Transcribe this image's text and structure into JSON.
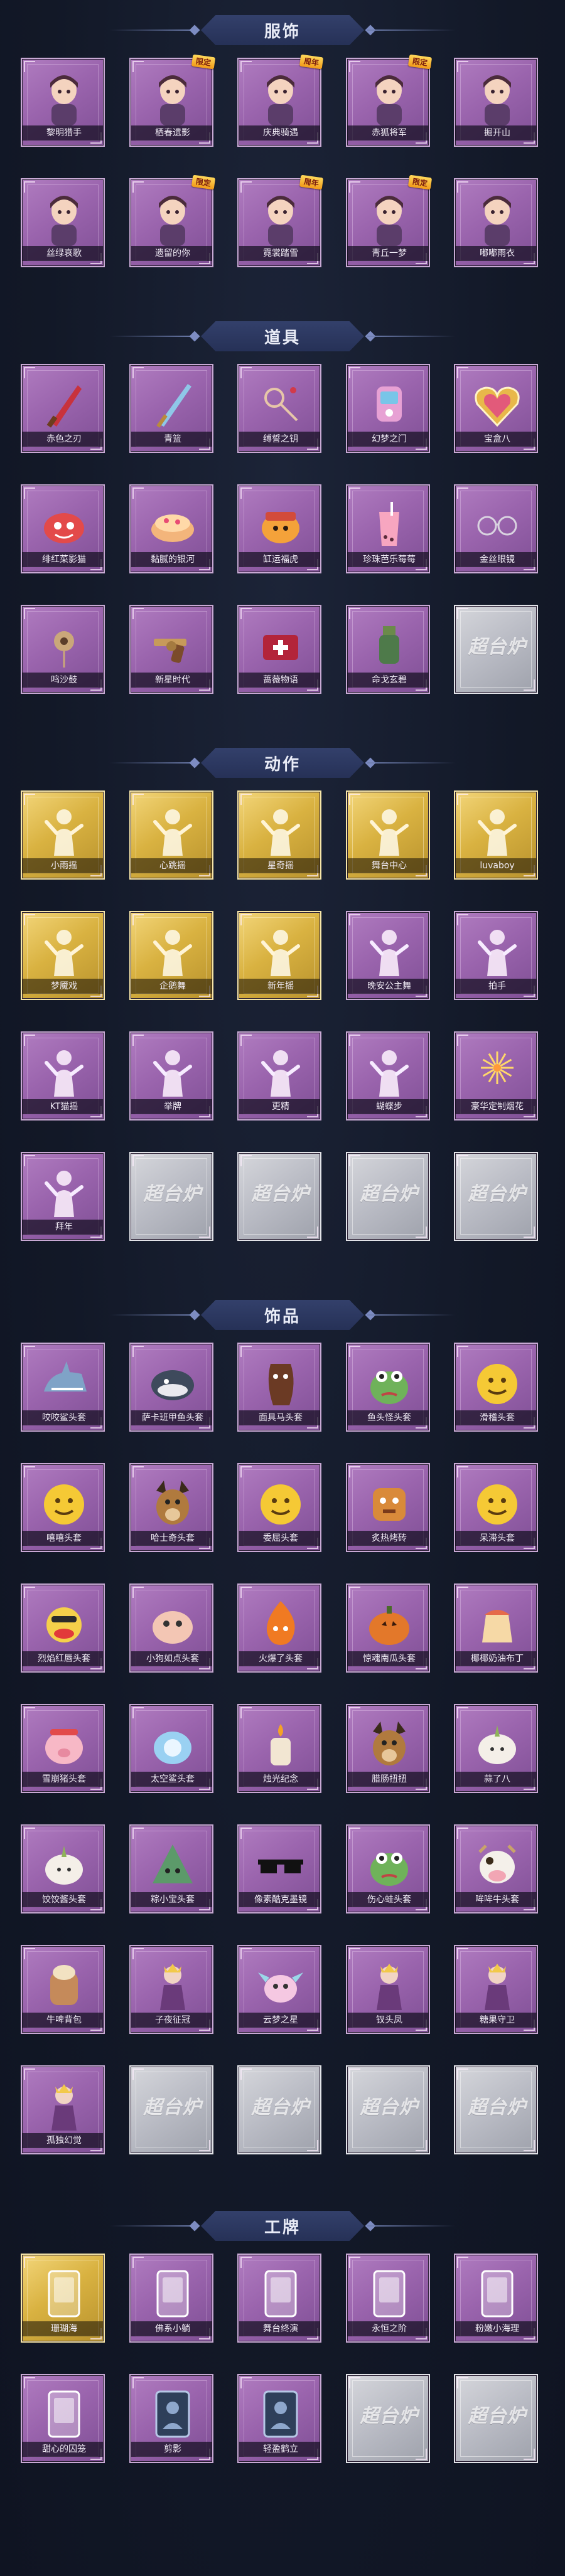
{
  "watermark_text": "超台炉",
  "sections": [
    {
      "title": "服饰",
      "items": [
        {
          "label": "黎明猎手",
          "style": "purple",
          "icon": "character-portrait-icon"
        },
        {
          "label": "栖春遗影",
          "style": "purple",
          "icon": "character-portrait-icon",
          "badge": "限定"
        },
        {
          "label": "庆典骑遇",
          "style": "purple",
          "icon": "character-portrait-icon",
          "badge": "周年"
        },
        {
          "label": "赤狐将军",
          "style": "purple",
          "icon": "character-portrait-icon",
          "badge": "限定"
        },
        {
          "label": "掘开山",
          "style": "purple",
          "icon": "character-portrait-icon"
        },
        {
          "label": "丝绿哀歌",
          "style": "purple",
          "icon": "character-portrait-icon"
        },
        {
          "label": "遗留的你",
          "style": "purple",
          "icon": "character-portrait-icon",
          "badge": "限定"
        },
        {
          "label": "霓裳踏雪",
          "style": "purple",
          "icon": "character-portrait-icon",
          "badge": "周年"
        },
        {
          "label": "青丘一梦",
          "style": "purple",
          "icon": "character-portrait-icon",
          "badge": "限定"
        },
        {
          "label": "嘟嘟雨衣",
          "style": "purple",
          "icon": "character-portrait-icon"
        }
      ]
    },
    {
      "title": "道具",
      "items": [
        {
          "label": "赤色之刃",
          "style": "purple",
          "icon": "blade-icon"
        },
        {
          "label": "青篮",
          "style": "purple",
          "icon": "sword-icon"
        },
        {
          "label": "缚誓之钥",
          "style": "purple",
          "icon": "key-icon"
        },
        {
          "label": "幻梦之门",
          "style": "purple",
          "icon": "device-icon"
        },
        {
          "label": "宝盒八",
          "style": "purple",
          "icon": "heart-box-icon"
        },
        {
          "label": "绯红菜影猫",
          "style": "purple",
          "icon": "red-cat-icon"
        },
        {
          "label": "黏腻的银河",
          "style": "purple",
          "icon": "cake-icon"
        },
        {
          "label": "缸运福虎",
          "style": "purple",
          "icon": "tiger-icon"
        },
        {
          "label": "珍珠芭乐莓莓",
          "style": "purple",
          "icon": "drink-icon"
        },
        {
          "label": "金丝眼镜",
          "style": "purple",
          "icon": "glasses-icon"
        },
        {
          "label": "鸣沙鼓",
          "style": "purple",
          "icon": "ornament-icon"
        },
        {
          "label": "新星时代",
          "style": "purple",
          "icon": "revolver-icon"
        },
        {
          "label": "蔷薇物语",
          "style": "purple",
          "icon": "medkit-icon"
        },
        {
          "label": "命戈玄碧",
          "style": "purple",
          "icon": "bottle-icon"
        },
        {
          "label": "",
          "style": "empty",
          "icon": "empty-slot-icon"
        }
      ]
    },
    {
      "title": "动作",
      "items": [
        {
          "label": "小雨摇",
          "style": "gold",
          "icon": "pose-figure-icon"
        },
        {
          "label": "心跳摇",
          "style": "gold",
          "icon": "pose-figure-icon"
        },
        {
          "label": "星奇摇",
          "style": "gold",
          "icon": "pose-figure-icon"
        },
        {
          "label": "舞台中心",
          "style": "gold",
          "icon": "pose-figure-icon"
        },
        {
          "label": "luvaboy",
          "style": "gold",
          "icon": "pose-figure-icon"
        },
        {
          "label": "梦魇戏",
          "style": "gold",
          "icon": "pose-figure-icon"
        },
        {
          "label": "企鹅舞",
          "style": "gold",
          "icon": "pose-figure-icon"
        },
        {
          "label": "新年摇",
          "style": "gold",
          "icon": "pose-figure-icon"
        },
        {
          "label": "晚安公主舞",
          "style": "purple",
          "icon": "pose-figure-icon"
        },
        {
          "label": "拍手",
          "style": "purple",
          "icon": "pose-figure-icon"
        },
        {
          "label": "KT猫摇",
          "style": "purple",
          "icon": "pose-figure-icon"
        },
        {
          "label": "举牌",
          "style": "purple",
          "icon": "pose-figure-icon"
        },
        {
          "label": "更精",
          "style": "purple",
          "icon": "pose-figure-icon"
        },
        {
          "label": "蝴蝶步",
          "style": "purple",
          "icon": "pose-figure-icon"
        },
        {
          "label": "豪华定制烟花",
          "style": "purple",
          "icon": "firework-icon"
        },
        {
          "label": "拜年",
          "style": "purple",
          "icon": "pose-figure-icon"
        },
        {
          "label": "",
          "style": "empty",
          "icon": "empty-slot-icon"
        },
        {
          "label": "",
          "style": "empty",
          "icon": "empty-slot-icon"
        },
        {
          "label": "",
          "style": "empty",
          "icon": "empty-slot-icon"
        },
        {
          "label": "",
          "style": "empty",
          "icon": "empty-slot-icon"
        }
      ]
    },
    {
      "title": "饰品",
      "items": [
        {
          "label": "咬咬鲨头套",
          "style": "purple",
          "icon": "shark-head-icon"
        },
        {
          "label": "萨卡班甲鱼头套",
          "style": "purple",
          "icon": "fish-head-icon"
        },
        {
          "label": "面具马头套",
          "style": "purple",
          "icon": "horse-head-icon"
        },
        {
          "label": "鱼头怪头套",
          "style": "purple",
          "icon": "frog-head-icon"
        },
        {
          "label": "滑稽头套",
          "style": "purple",
          "icon": "emoji-head-icon"
        },
        {
          "label": "嘻嘻头套",
          "style": "purple",
          "icon": "emoji-head-icon"
        },
        {
          "label": "哈士奇头套",
          "style": "purple",
          "icon": "dog-head-icon"
        },
        {
          "label": "委屈头套",
          "style": "purple",
          "icon": "emoji-head-icon"
        },
        {
          "label": "炙热烤砖",
          "style": "purple",
          "icon": "toast-head-icon"
        },
        {
          "label": "呆滞头套",
          "style": "purple",
          "icon": "emoji-head-icon"
        },
        {
          "label": "烈焰红唇头套",
          "style": "purple",
          "icon": "duck-head-icon"
        },
        {
          "label": "小狗如点头套",
          "style": "purple",
          "icon": "blob-head-icon"
        },
        {
          "label": "火爆了头套",
          "style": "purple",
          "icon": "fire-head-icon"
        },
        {
          "label": "惊魂南瓜头套",
          "style": "purple",
          "icon": "pumpkin-head-icon"
        },
        {
          "label": "椰椰奶油布丁",
          "style": "purple",
          "icon": "pudding-head-icon"
        },
        {
          "label": "雪崩猪头套",
          "style": "purple",
          "icon": "pig-head-icon"
        },
        {
          "label": "太空鲨头套",
          "style": "purple",
          "icon": "space-shark-icon"
        },
        {
          "label": "烛光纪念",
          "style": "purple",
          "icon": "candle-head-icon"
        },
        {
          "label": "腊肠扭扭",
          "style": "purple",
          "icon": "sausage-dog-icon"
        },
        {
          "label": "蒜了八",
          "style": "purple",
          "icon": "garlic-head-icon"
        },
        {
          "label": "饺饺酱头套",
          "style": "purple",
          "icon": "dumpling-head-icon"
        },
        {
          "label": "粽小宝头套",
          "style": "purple",
          "icon": "zongzi-head-icon"
        },
        {
          "label": "像素酷克墨镜",
          "style": "purple",
          "icon": "pixel-sunglasses-icon"
        },
        {
          "label": "伤心蛙头套",
          "style": "purple",
          "icon": "sad-frog-icon"
        },
        {
          "label": "哞哞牛头套",
          "style": "purple",
          "icon": "cow-head-icon"
        },
        {
          "label": "牛啤背包",
          "style": "purple",
          "icon": "backpack-icon"
        },
        {
          "label": "子夜征冠",
          "style": "purple",
          "icon": "crown-figure-icon"
        },
        {
          "label": "云梦之星",
          "style": "purple",
          "icon": "dragon-icon"
        },
        {
          "label": "钗头凤",
          "style": "purple",
          "icon": "hairpin-figure-icon"
        },
        {
          "label": "糖果守卫",
          "style": "purple",
          "icon": "candy-guard-icon"
        },
        {
          "label": "孤独幻觉",
          "style": "purple",
          "icon": "dream-figure-icon"
        },
        {
          "label": "",
          "style": "empty",
          "icon": "empty-slot-icon"
        },
        {
          "label": "",
          "style": "empty",
          "icon": "empty-slot-icon"
        },
        {
          "label": "",
          "style": "empty",
          "icon": "empty-slot-icon"
        },
        {
          "label": "",
          "style": "empty",
          "icon": "empty-slot-icon"
        }
      ]
    },
    {
      "title": "工牌",
      "items": [
        {
          "label": "珊瑚海",
          "style": "gold",
          "icon": "badge-frame-icon"
        },
        {
          "label": "佛系小躺",
          "style": "purple",
          "icon": "badge-frame-icon"
        },
        {
          "label": "舞台终演",
          "style": "purple",
          "icon": "badge-frame-icon"
        },
        {
          "label": "永恒之阶",
          "style": "purple",
          "icon": "badge-frame-icon"
        },
        {
          "label": "粉嫩小海理",
          "style": "purple",
          "icon": "badge-frame-icon"
        },
        {
          "label": "甜心的囚笼",
          "style": "purple",
          "icon": "badge-frame-icon"
        },
        {
          "label": "剪影",
          "style": "purple",
          "icon": "silhouette-badge-icon"
        },
        {
          "label": "轻盈鹤立",
          "style": "purple",
          "icon": "silhouette-badge-icon"
        },
        {
          "label": "",
          "style": "empty",
          "icon": "empty-slot-icon"
        },
        {
          "label": "",
          "style": "empty",
          "icon": "empty-slot-icon"
        }
      ]
    }
  ]
}
